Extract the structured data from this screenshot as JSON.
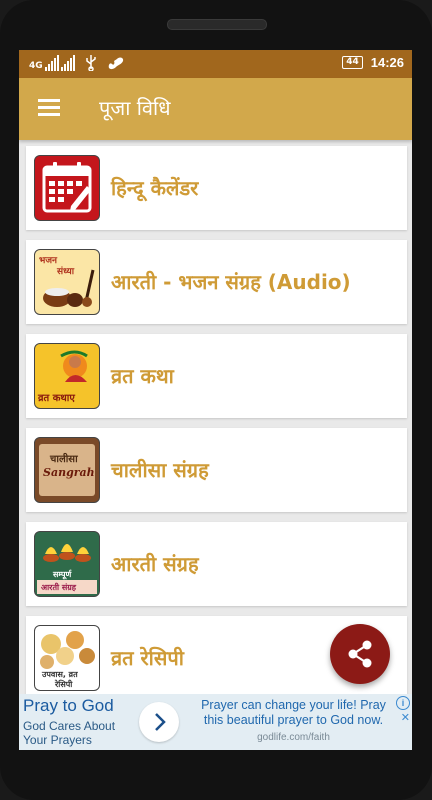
{
  "status_bar": {
    "network": "4G",
    "battery": "44",
    "time": "14:26",
    "icons": [
      "signal-icon",
      "usb-icon",
      "voicemail-icon"
    ]
  },
  "app_bar": {
    "title": "पूजा विधि",
    "menu_icon": "hamburger-menu-icon"
  },
  "menu_items": [
    {
      "label": "हिन्दू कैलेंडर",
      "icon": "calendar-icon"
    },
    {
      "label": "आरती - भजन संग्रह (Audio)",
      "icon": "bhajan-sandhya-icon",
      "icon_text": [
        "भजन",
        "संध्या"
      ]
    },
    {
      "label": "व्रत कथा",
      "icon": "vrat-katha-icon",
      "icon_text": "व्रत कथाए"
    },
    {
      "label": "चालीसा संग्रह",
      "icon": "chalisa-sangrah-icon",
      "icon_text": [
        "चालीसा",
        "Sangrah"
      ]
    },
    {
      "label": "आरती संग्रह",
      "icon": "aarti-sangrah-icon",
      "icon_text": [
        "सम्पूर्ण",
        "आरती संग्रह"
      ]
    },
    {
      "label": "व्रत रेसिपी",
      "icon": "vrat-recipe-icon",
      "icon_text": [
        "उपवास, व्रत",
        "रेसिपी"
      ]
    }
  ],
  "fab": {
    "icon": "share-icon"
  },
  "ad": {
    "headline": "Pray to God",
    "subtext": "God Cares About Your Prayers",
    "body": "Prayer can change your life! Pray this beautiful prayer to God now.",
    "url": "godlife.com/faith",
    "info": "i",
    "close": "✕"
  }
}
